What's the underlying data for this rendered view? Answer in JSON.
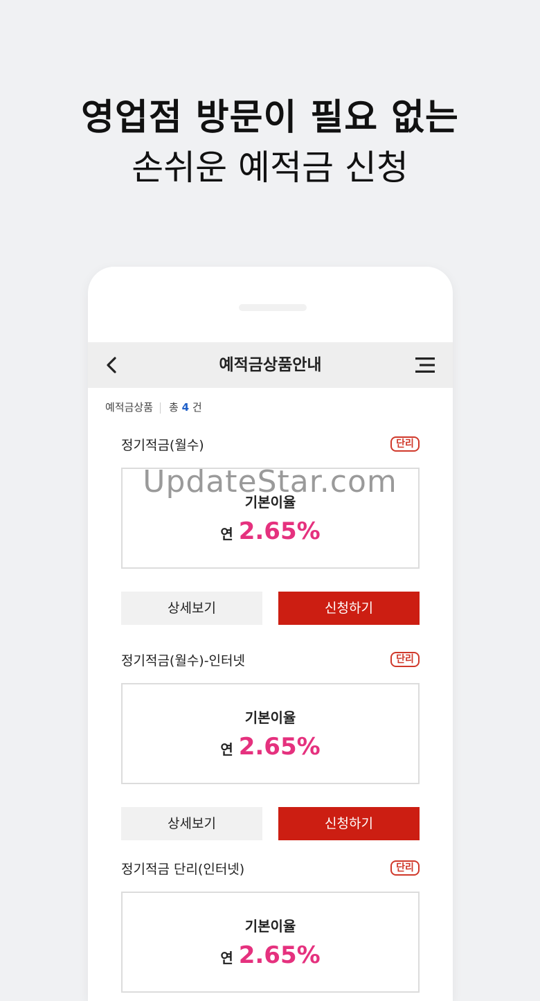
{
  "headline": {
    "line1": "영업점 방문이 필요 없는",
    "line2": "손쉬운 예적금 신청"
  },
  "navbar": {
    "title": "예적금상품안내",
    "back_icon": "chevron-left-icon",
    "menu_icon": "hamburger-menu-icon"
  },
  "summary": {
    "category": "예적금상품",
    "total_prefix": "총",
    "count": "4",
    "unit": "건"
  },
  "products": [
    {
      "name": "정기적금(월수)",
      "badge": "단리",
      "rate_label": "기본이율",
      "rate_prefix": "연",
      "rate_value": "2.65%",
      "detail_label": "상세보기",
      "apply_label": "신청하기"
    },
    {
      "name": "정기적금(월수)-인터넷",
      "badge": "단리",
      "rate_label": "기본이율",
      "rate_prefix": "연",
      "rate_value": "2.65%",
      "detail_label": "상세보기",
      "apply_label": "신청하기"
    },
    {
      "name": "정기적금 단리(인터넷)",
      "badge": "단리",
      "rate_label": "기본이율",
      "rate_prefix": "연",
      "rate_value": "2.65%"
    }
  ],
  "watermark": "UpdateStar.com",
  "colors": {
    "accent_rate": "#e5317e",
    "apply_button": "#cc1e12",
    "badge": "#d0382a",
    "count": "#1f5fc8"
  }
}
